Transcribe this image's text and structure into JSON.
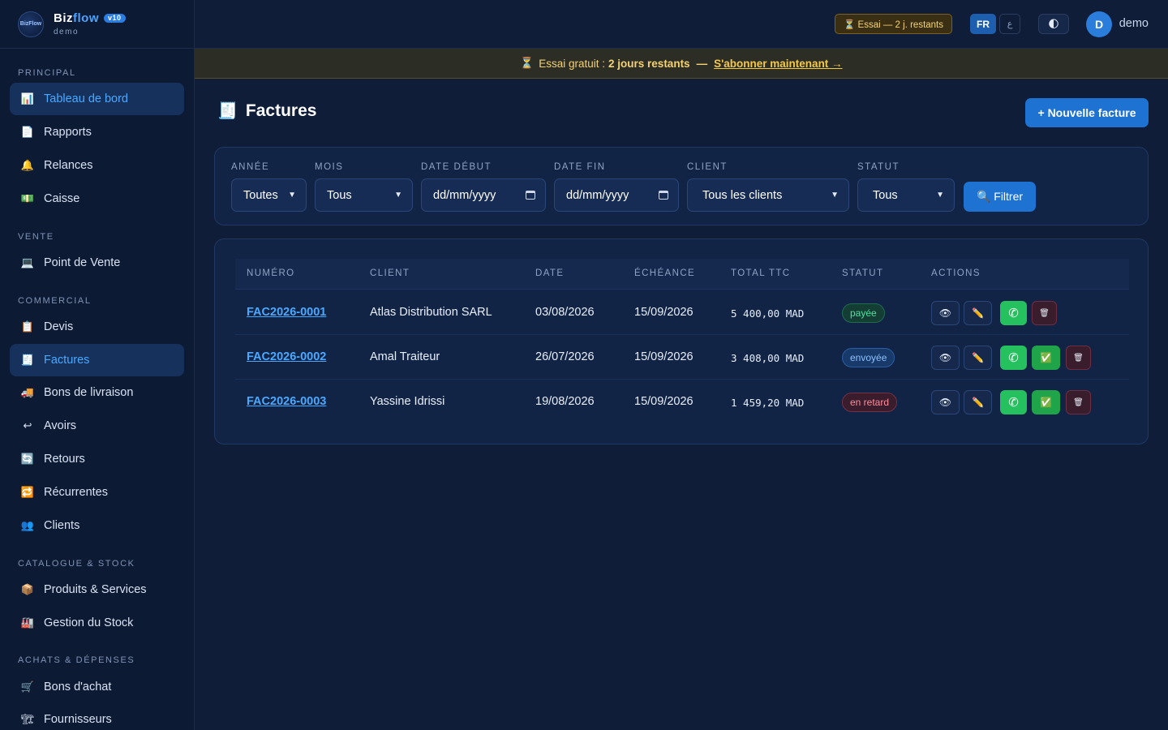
{
  "brand": {
    "logo_text": "BizFlow",
    "name_a": "Biz",
    "name_b": "flow",
    "version": "v10",
    "workspace": "demo"
  },
  "sidebar": {
    "sections": {
      "principal": "PRINCIPAL",
      "vente": "VENTE",
      "commercial": "COMMERCIAL",
      "catalogue": "CATALOGUE & STOCK",
      "achats": "ACHATS & DÉPENSES"
    },
    "items": [
      {
        "label": "Tableau de bord",
        "icon": "chart-icon",
        "glyph": "📊"
      },
      {
        "label": "Rapports",
        "icon": "report-icon",
        "glyph": "📄"
      },
      {
        "label": "Relances",
        "icon": "bell-icon",
        "glyph": "🔔"
      },
      {
        "label": "Caisse",
        "icon": "cash-icon",
        "glyph": "💵"
      },
      {
        "label": "Point de Vente",
        "icon": "monitor-icon",
        "glyph": "💻"
      },
      {
        "label": "Devis",
        "icon": "clipboard-icon",
        "glyph": "📋"
      },
      {
        "label": "Factures",
        "icon": "invoice-icon",
        "glyph": "🧾"
      },
      {
        "label": "Bons de livraison",
        "icon": "truck-icon",
        "glyph": "🚚"
      },
      {
        "label": "Avoirs",
        "icon": "return-arrow-icon",
        "glyph": "↩"
      },
      {
        "label": "Retours",
        "icon": "refresh-icon",
        "glyph": "🔄"
      },
      {
        "label": "Récurrentes",
        "icon": "repeat-icon",
        "glyph": "🔁"
      },
      {
        "label": "Clients",
        "icon": "users-icon",
        "glyph": "👥"
      },
      {
        "label": "Produits & Services",
        "icon": "box-icon",
        "glyph": "📦"
      },
      {
        "label": "Gestion du Stock",
        "icon": "warehouse-icon",
        "glyph": "🏭"
      },
      {
        "label": "Bons d'achat",
        "icon": "cart-icon",
        "glyph": "🛒"
      },
      {
        "label": "Fournisseurs",
        "icon": "supplier-icon",
        "glyph": "🏗"
      }
    ]
  },
  "topbar": {
    "trial_pill": "⏳ Essai — 2 j. restants",
    "lang_fr": "FR",
    "lang_ar": "ع",
    "theme_icon": "🌓",
    "avatar_initial": "D",
    "user_name": "demo"
  },
  "banner": {
    "icon": "⏳",
    "text_a": "Essai gratuit :",
    "text_b": "2 jours restants",
    "text_c": "—",
    "link": "S'abonner maintenant →"
  },
  "page": {
    "title_icon": "🧾",
    "title": "Factures",
    "new_button": "+ Nouvelle facture"
  },
  "filters": {
    "annee_label": "ANNÉE",
    "annee_value": "Toutes",
    "mois_label": "MOIS",
    "mois_value": "Tous",
    "date_debut_label": "DATE DÉBUT",
    "date_debut_placeholder": "dd/mm/yyyy",
    "date_fin_label": "DATE FIN",
    "date_fin_placeholder": "dd/mm/yyyy",
    "client_label": "CLIENT",
    "client_value": "Tous les clients",
    "statut_label": "STATUT",
    "statut_value": "Tous",
    "filter_button": "🔍 Filtrer"
  },
  "table": {
    "columns": [
      "NUMÉRO",
      "CLIENT",
      "DATE",
      "ÉCHÉANCE",
      "TOTAL TTC",
      "STATUT",
      "ACTIONS"
    ],
    "rows": [
      {
        "numero": "FAC2026-0001",
        "client": "Atlas Distribution SARL",
        "date": "03/08/2026",
        "echeance": "15/09/2026",
        "total": "5 400,00 MAD",
        "statut": "payée",
        "status_kind": "paid"
      },
      {
        "numero": "FAC2026-0002",
        "client": "Amal Traiteur",
        "date": "26/07/2026",
        "echeance": "15/09/2026",
        "total": "3 408,00 MAD",
        "statut": "envoyée",
        "status_kind": "sent"
      },
      {
        "numero": "FAC2026-0003",
        "client": "Yassine Idrissi",
        "date": "19/08/2026",
        "echeance": "15/09/2026",
        "total": "1 459,20 MAD",
        "statut": "en retard",
        "status_kind": "late"
      }
    ],
    "action_glyphs": {
      "view": "👁",
      "edit": "✏️",
      "whatsapp": "✆",
      "mark_paid": "✅",
      "delete": "🗑"
    }
  },
  "colors": {
    "accent": "#1d72d2",
    "link": "#4aa8ff",
    "paid": "#4ee2a0",
    "sent": "#8cc1ff",
    "late": "#ff8a99",
    "whatsapp": "#25c15e"
  }
}
